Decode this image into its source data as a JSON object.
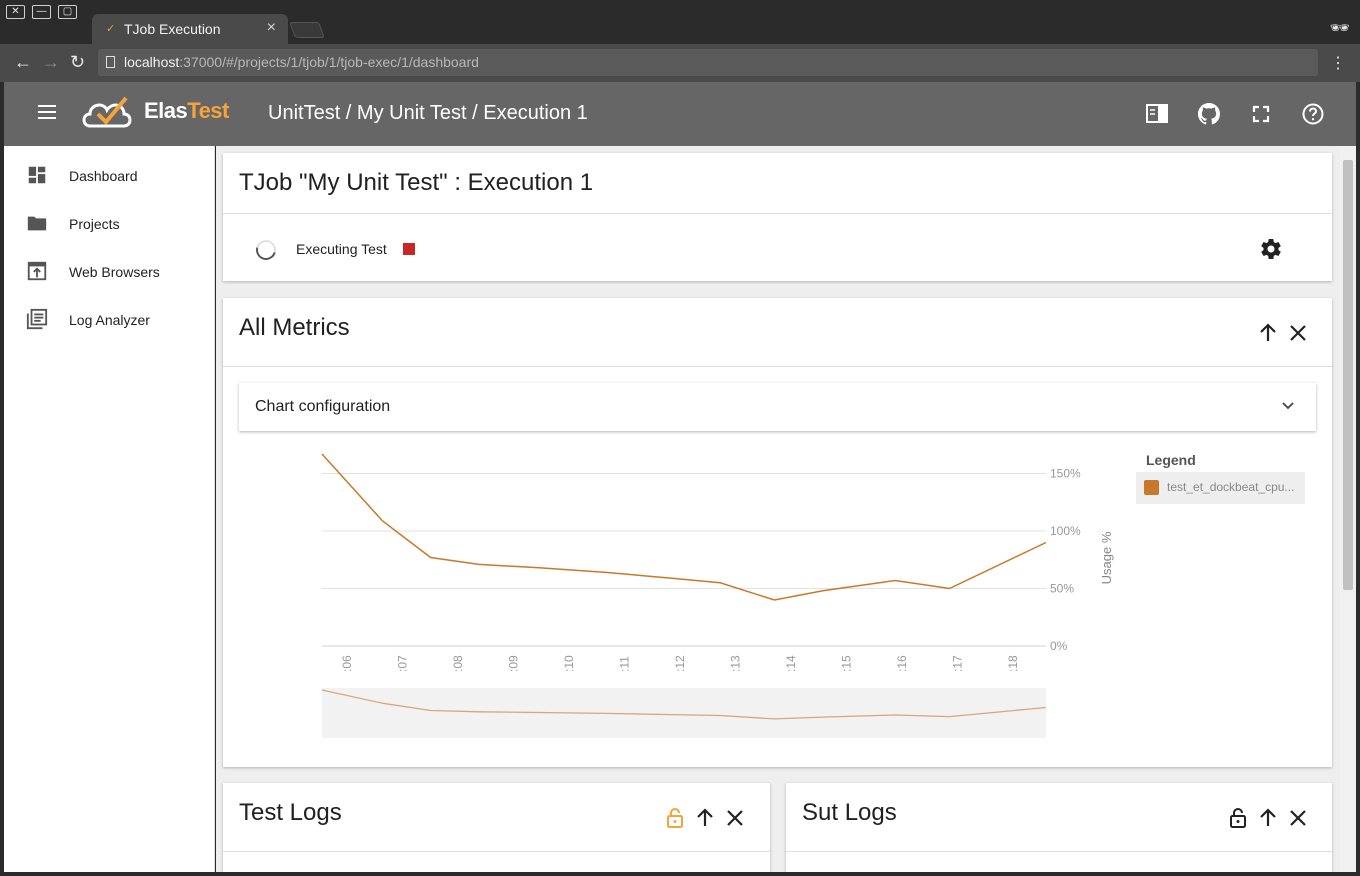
{
  "browser": {
    "tab_title": "TJob Execution",
    "url_host": "localhost",
    "url_path": ":37000/#/projects/1/tjob/1/tjob-exec/1/dashboard"
  },
  "header": {
    "logo_text_main": "Elas",
    "logo_text_accent": "Test",
    "breadcrumb": "UnitTest / My Unit Test / Execution 1"
  },
  "sidebar": {
    "items": [
      {
        "label": "Dashboard",
        "icon": "dashboard-icon"
      },
      {
        "label": "Projects",
        "icon": "folder-icon"
      },
      {
        "label": "Web Browsers",
        "icon": "browser-icon"
      },
      {
        "label": "Log Analyzer",
        "icon": "log-icon"
      }
    ]
  },
  "execution": {
    "title": "TJob \"My Unit Test\" : Execution 1",
    "status": "Executing Test",
    "stop_color": "#c62828"
  },
  "metrics": {
    "title": "All Metrics",
    "config_label": "Chart configuration",
    "legend_title": "Legend",
    "legend_item": "test_et_dockbeat_cpu...",
    "series_color": "#c8782a"
  },
  "chart_data": {
    "type": "line",
    "x": [
      ":06",
      ":07",
      ":08",
      ":09",
      ":10",
      ":11",
      ":12",
      ":13",
      ":14",
      ":15",
      ":16",
      ":17",
      ":18"
    ],
    "series": [
      {
        "name": "test_et_dockbeat_cpu...",
        "points": [
          [
            5.5,
            167
          ],
          [
            6.5,
            109
          ],
          [
            7.3,
            77
          ],
          [
            8.1,
            71
          ],
          [
            9.1,
            68
          ],
          [
            10.2,
            64
          ],
          [
            11.3,
            59
          ],
          [
            12.1,
            55
          ],
          [
            13.0,
            40
          ],
          [
            13.8,
            48
          ],
          [
            15.0,
            57
          ],
          [
            15.9,
            50
          ],
          [
            17.5,
            90
          ]
        ]
      }
    ],
    "ylabel": "Usage %",
    "yticks": [
      "0%",
      "50%",
      "100%",
      "150%"
    ],
    "ylim": [
      0,
      167
    ],
    "xlim": [
      5.5,
      17.5
    ],
    "grid": true,
    "legend": "right"
  },
  "logs": {
    "test_title": "Test Logs",
    "sut_title": "Sut Logs"
  },
  "colors": {
    "header_bg": "#666666",
    "accent": "#f5a33b",
    "lock_active": "#f5a33b"
  }
}
